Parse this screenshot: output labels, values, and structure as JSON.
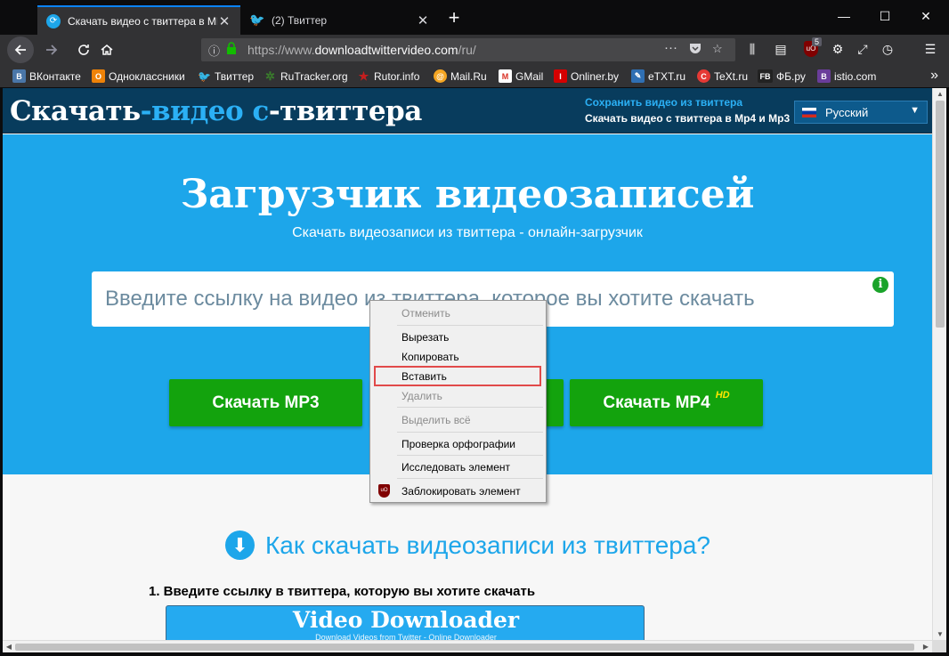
{
  "browser": {
    "tabs": [
      {
        "title": "Скачать видео с твиттера в MP",
        "active": true
      },
      {
        "title": "(2) Твиттер",
        "active": false
      }
    ],
    "url": {
      "prefix": "https://www.",
      "domain": "downloadtwittervideo.com",
      "path": "/ru/"
    },
    "ublock_count": "5",
    "bookmarks": [
      {
        "label": "ВКонтакте",
        "icon": "vk-icon",
        "color": "#4a76a8",
        "glyph": "B"
      },
      {
        "label": "Одноклассники",
        "icon": "ok-icon",
        "color": "#ee8208",
        "glyph": "O"
      },
      {
        "label": "Твиттер",
        "icon": "twitter-icon",
        "color": "#1da1f2",
        "glyph": "🐦"
      },
      {
        "label": "RuTracker.org",
        "icon": "rutracker-icon",
        "color": "#3a7d2c",
        "glyph": "✲"
      },
      {
        "label": "Rutor.info",
        "icon": "rutor-icon",
        "color": "#c41e1e",
        "glyph": "★"
      },
      {
        "label": "Mail.Ru",
        "icon": "mailru-icon",
        "color": "#f5a623",
        "glyph": "@"
      },
      {
        "label": "GMail",
        "icon": "gmail-icon",
        "color": "#d93025",
        "glyph": "M"
      },
      {
        "label": "Onliner.by",
        "icon": "onliner-icon",
        "color": "#d50000",
        "glyph": "I"
      },
      {
        "label": "eTXT.ru",
        "icon": "etxt-icon",
        "color": "#2f6fb3",
        "glyph": "✎"
      },
      {
        "label": "TeXt.ru",
        "icon": "text-ru-icon",
        "color": "#e53935",
        "glyph": "C"
      },
      {
        "label": "ФБ.ру",
        "icon": "fb-icon",
        "color": "#222222",
        "glyph": "FB"
      },
      {
        "label": "istio.com",
        "icon": "istio-icon",
        "color": "#6a3d9a",
        "glyph": "B"
      }
    ]
  },
  "site": {
    "logo": {
      "part1": "Скачать",
      "part2": "-видео с",
      "part3": "-твиттера"
    },
    "header_title": "Сохранить видео из твиттера",
    "header_sub": "Скачать видео с твиттера в Mp4 и Mp3",
    "language": "Русский",
    "hero_title": "Загрузчик видеозаписей",
    "hero_sub": "Скачать видеозаписи из твиттера - онлайн-загрузчик",
    "input_placeholder": "Введите ссылку на видео из твиттера, которое вы хотите скачать",
    "btn_mp3": "Скачать MP3",
    "btn_mp4": "Скачать MP4",
    "hd_badge": "HD",
    "howto": "Как скачать видеозаписи из твиттера?",
    "step1": "1. Введите ссылку в твиттера, которую вы хотите скачать",
    "preview_title": "Video Downloader",
    "preview_sub": "Download Videos from Twitter - Online Downloader"
  },
  "context_menu": {
    "undo": "Отменить",
    "cut": "Вырезать",
    "copy": "Копировать",
    "paste": "Вставить",
    "delete": "Удалить",
    "select_all": "Выделить всё",
    "spellcheck": "Проверка орфографии",
    "inspect": "Исследовать элемент",
    "block": "Заблокировать элемент"
  }
}
